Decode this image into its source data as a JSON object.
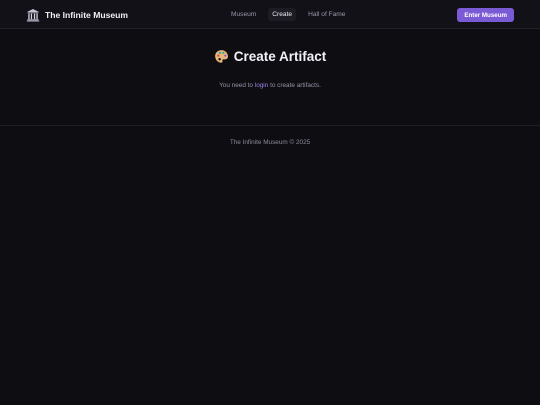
{
  "header": {
    "brand_title": "The Infinite Museum",
    "nav": [
      {
        "label": "Museum"
      },
      {
        "label": "Create"
      },
      {
        "label": "Hall of Fame"
      }
    ],
    "active_nav": "Create",
    "cta_label": "Enter Museum",
    "brand_icon": "museum-building-icon"
  },
  "main": {
    "title": "Create Artifact",
    "title_icon": "palette-icon",
    "notice_prefix": "You need to ",
    "notice_link": "login",
    "notice_suffix": " to create artifacts."
  },
  "footer": {
    "text": "The Infinite Museum © 2025"
  },
  "colors": {
    "background": "#0e0d12",
    "header_background": "#121118",
    "accent": "#7b5ad6",
    "link": "#9c82ec"
  }
}
